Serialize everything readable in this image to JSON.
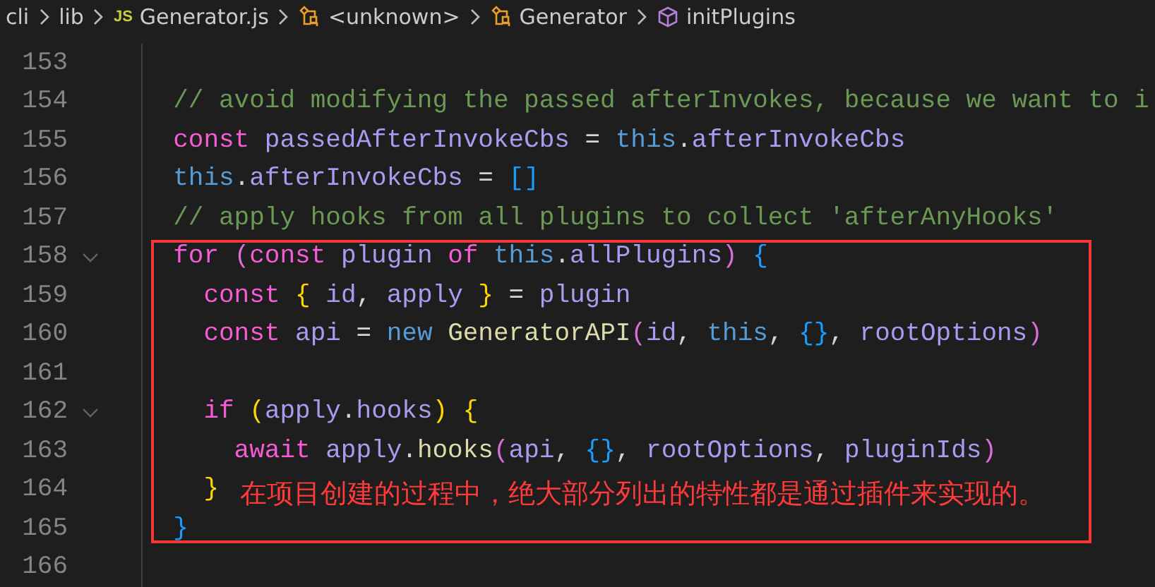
{
  "breadcrumb": [
    {
      "label": "cli",
      "kind": "folder"
    },
    {
      "label": "lib",
      "kind": "folder"
    },
    {
      "label": "Generator.js",
      "kind": "file",
      "badge": "JS"
    },
    {
      "label": "<unknown>",
      "kind": "class"
    },
    {
      "label": "Generator",
      "kind": "class"
    },
    {
      "label": "initPlugins",
      "kind": "method"
    }
  ],
  "lines": [
    {
      "number": "153",
      "foldable": false
    },
    {
      "number": "154",
      "foldable": false,
      "tokens": [
        {
          "text": "  // avoid modifying the passed afterInvokes, because we want to i",
          "kind": "comment"
        }
      ]
    },
    {
      "number": "155",
      "foldable": false,
      "tokens": [
        {
          "text": "  const",
          "kind": "keyword"
        },
        {
          "text": " passedAfterInvokeCbs ",
          "kind": "var"
        },
        {
          "text": "= ",
          "kind": "op"
        },
        {
          "text": "this",
          "kind": "this"
        },
        {
          "text": ".",
          "kind": "op"
        },
        {
          "text": "afterInvokeCbs",
          "kind": "var"
        }
      ]
    },
    {
      "number": "156",
      "foldable": false,
      "tokens": [
        {
          "text": "  this",
          "kind": "this"
        },
        {
          "text": ".",
          "kind": "op"
        },
        {
          "text": "afterInvokeCbs ",
          "kind": "var"
        },
        {
          "text": "= ",
          "kind": "op"
        },
        {
          "text": "[]",
          "kind": "bracket3"
        }
      ]
    },
    {
      "number": "157",
      "foldable": false,
      "tokens": [
        {
          "text": "  // apply hooks from all plugins to collect 'afterAnyHooks'",
          "kind": "comment"
        }
      ]
    },
    {
      "number": "158",
      "foldable": true,
      "tokens": [
        {
          "text": "  for ",
          "kind": "keyword"
        },
        {
          "text": "(",
          "kind": "bracket2"
        },
        {
          "text": "const",
          "kind": "keyword"
        },
        {
          "text": " plugin ",
          "kind": "var"
        },
        {
          "text": "of ",
          "kind": "keyword"
        },
        {
          "text": "this",
          "kind": "this"
        },
        {
          "text": ".",
          "kind": "op"
        },
        {
          "text": "allPlugins",
          "kind": "var"
        },
        {
          "text": ") ",
          "kind": "bracket2"
        },
        {
          "text": "{",
          "kind": "bracket3"
        }
      ]
    },
    {
      "number": "159",
      "foldable": false,
      "tokens": [
        {
          "text": "    const ",
          "kind": "keyword"
        },
        {
          "text": "{ ",
          "kind": "bracket1"
        },
        {
          "text": "id",
          "kind": "var"
        },
        {
          "text": ", ",
          "kind": "op"
        },
        {
          "text": "apply ",
          "kind": "var"
        },
        {
          "text": "} ",
          "kind": "bracket1"
        },
        {
          "text": "= ",
          "kind": "op"
        },
        {
          "text": "plugin",
          "kind": "var"
        }
      ]
    },
    {
      "number": "160",
      "foldable": false,
      "tokens": [
        {
          "text": "    const ",
          "kind": "keyword"
        },
        {
          "text": "api ",
          "kind": "var"
        },
        {
          "text": "= ",
          "kind": "op"
        },
        {
          "text": "new ",
          "kind": "this"
        },
        {
          "text": "GeneratorAPI",
          "kind": "function"
        },
        {
          "text": "(",
          "kind": "bracket2"
        },
        {
          "text": "id",
          "kind": "var"
        },
        {
          "text": ", ",
          "kind": "op"
        },
        {
          "text": "this",
          "kind": "this"
        },
        {
          "text": ", ",
          "kind": "op"
        },
        {
          "text": "{}",
          "kind": "bracket3"
        },
        {
          "text": ", ",
          "kind": "op"
        },
        {
          "text": "rootOptions",
          "kind": "var"
        },
        {
          "text": ")",
          "kind": "bracket2"
        }
      ]
    },
    {
      "number": "161",
      "foldable": false
    },
    {
      "number": "162",
      "foldable": true,
      "tokens": [
        {
          "text": "    if ",
          "kind": "keyword"
        },
        {
          "text": "(",
          "kind": "bracket1"
        },
        {
          "text": "apply",
          "kind": "var"
        },
        {
          "text": ".",
          "kind": "op"
        },
        {
          "text": "hooks",
          "kind": "var"
        },
        {
          "text": ") ",
          "kind": "bracket1"
        },
        {
          "text": "{",
          "kind": "bracket1"
        }
      ]
    },
    {
      "number": "163",
      "foldable": false,
      "tokens": [
        {
          "text": "      await ",
          "kind": "keyword"
        },
        {
          "text": "apply",
          "kind": "var"
        },
        {
          "text": ".",
          "kind": "op"
        },
        {
          "text": "hooks",
          "kind": "function"
        },
        {
          "text": "(",
          "kind": "bracket2"
        },
        {
          "text": "api",
          "kind": "var"
        },
        {
          "text": ", ",
          "kind": "op"
        },
        {
          "text": "{}",
          "kind": "bracket3"
        },
        {
          "text": ", ",
          "kind": "op"
        },
        {
          "text": "rootOptions",
          "kind": "var"
        },
        {
          "text": ", ",
          "kind": "op"
        },
        {
          "text": "pluginIds",
          "kind": "var"
        },
        {
          "text": ")",
          "kind": "bracket2"
        }
      ]
    },
    {
      "number": "164",
      "foldable": false,
      "tokens": [
        {
          "text": "    }",
          "kind": "bracket1"
        }
      ]
    },
    {
      "number": "165",
      "foldable": false,
      "tokens": [
        {
          "text": "  }",
          "kind": "bracket3"
        }
      ]
    },
    {
      "number": "166",
      "foldable": false
    }
  ],
  "annotation": {
    "text": "在项目创建的过程中，绝大部分列出的特性都是通过插件来实现的。"
  }
}
